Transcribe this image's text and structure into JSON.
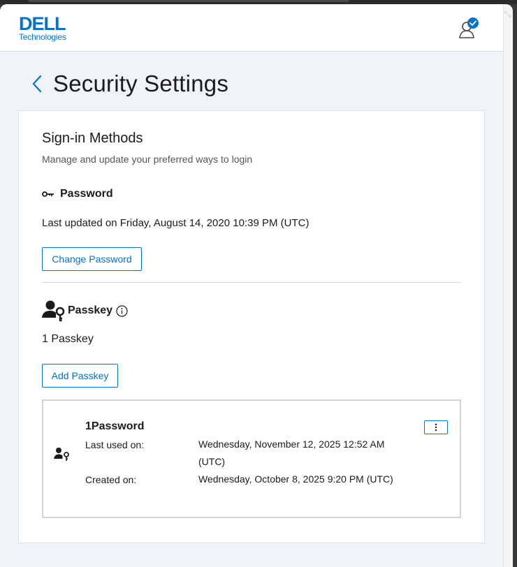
{
  "brand": {
    "wordmark": "DELL",
    "sub": "Technologies",
    "color": "#0672cb"
  },
  "header": {
    "user_icon": "user-verified-icon"
  },
  "page": {
    "title": "Security Settings",
    "back_icon": "chevron-left-icon"
  },
  "signin": {
    "title": "Sign-in Methods",
    "subtitle": "Manage and update your preferred ways to login"
  },
  "password": {
    "icon": "key-icon",
    "label": "Password",
    "last_updated": "Last updated on Friday, August 14, 2020 10:39 PM (UTC)",
    "change_button": "Change Password"
  },
  "passkey": {
    "icon": "user-key-icon",
    "label": "Passkey",
    "info_icon": "info-icon",
    "count": "1 Passkey",
    "add_button": "Add Passkey",
    "items": [
      {
        "name": "1Password",
        "last_used_label": "Last used on:",
        "last_used_value": "Wednesday, November 12, 2025 12:52 AM (UTC)",
        "created_label": "Created on:",
        "created_value": "Wednesday, October 8, 2025 9:20 PM (UTC)",
        "menu_icon": "kebab-menu-icon"
      }
    ]
  }
}
